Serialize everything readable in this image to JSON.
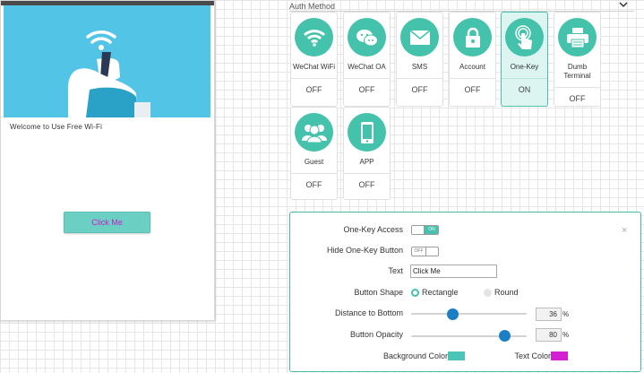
{
  "preview": {
    "welcome_text": "Welcome to Use Free Wi-Fi",
    "button_label": "Click Me",
    "hero_color": "#52c4e6",
    "button_color": "#6ccfc4",
    "button_text_color": "#c71fc7"
  },
  "auth": {
    "title": "Auth Method",
    "tiles": [
      {
        "name": "WeChat WiFi",
        "icon": "wifi-icon",
        "state": "OFF",
        "active": false
      },
      {
        "name": "WeChat OA",
        "icon": "chat-bubbles-icon",
        "state": "OFF",
        "active": false
      },
      {
        "name": "SMS",
        "icon": "envelope-icon",
        "state": "OFF",
        "active": false
      },
      {
        "name": "Account",
        "icon": "lock-icon",
        "state": "OFF",
        "active": false
      },
      {
        "name": "One-Key",
        "icon": "tap-finger-icon",
        "state": "ON",
        "active": true
      },
      {
        "name": "Dumb\nTerminal",
        "icon": "printer-icon",
        "state": "OFF",
        "active": false
      },
      {
        "name": "Guest",
        "icon": "users-icon",
        "state": "OFF",
        "active": false
      },
      {
        "name": "APP",
        "icon": "phone-icon",
        "state": "OFF",
        "active": false
      }
    ]
  },
  "settings": {
    "one_key_access": {
      "label": "One-Key Access",
      "on": true,
      "on_text": "ON"
    },
    "hide_button": {
      "label": "Hide One-Key Button",
      "on": false,
      "off_text": "OFF"
    },
    "text": {
      "label": "Text",
      "value": "Click Me"
    },
    "button_shape": {
      "label": "Button Shape",
      "options": [
        "Rectangle",
        "Round"
      ],
      "selected": "Rectangle"
    },
    "distance_to_bottom": {
      "label": "Distance to Bottom",
      "value": "36",
      "unit": "%"
    },
    "button_opacity": {
      "label": "Button Opacity",
      "value": "80",
      "unit": "%"
    },
    "background_color": {
      "label": "Background Color",
      "color": "#4cc5b8"
    },
    "text_color": {
      "label": "Text Color",
      "color": "#d21fd2"
    }
  }
}
